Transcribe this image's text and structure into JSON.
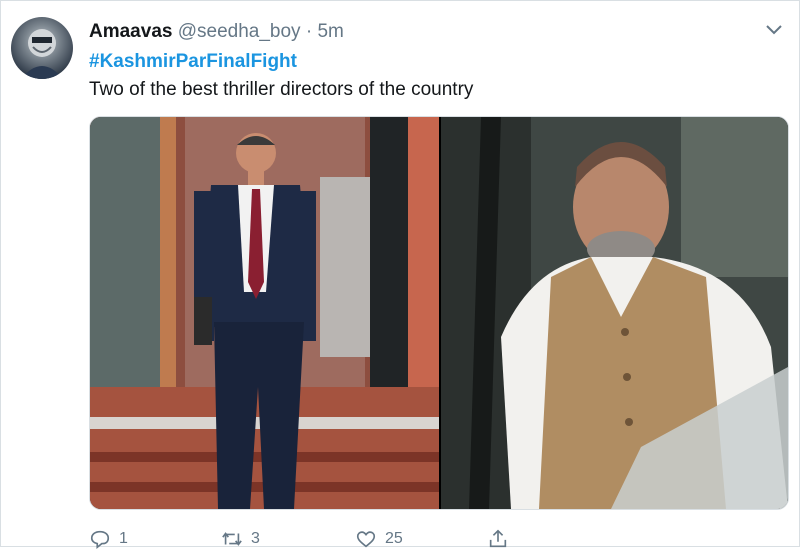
{
  "tweet": {
    "author_name": "Amaavas",
    "handle": "@seedha_boy",
    "separator": "·",
    "time": "5m",
    "hashtag": "#KashmirParFinalFight",
    "text": "Two of the best thriller directors of the country"
  },
  "actions": {
    "replies": "1",
    "retweets": "3",
    "likes": "25"
  },
  "icons": {
    "menu": "chevron-down-icon",
    "reply": "reply-icon",
    "retweet": "retweet-icon",
    "like": "heart-icon",
    "share": "share-icon"
  },
  "colors": {
    "hashtag": "#1b95e0",
    "secondary_text": "#657786",
    "primary_text": "#14171a"
  }
}
